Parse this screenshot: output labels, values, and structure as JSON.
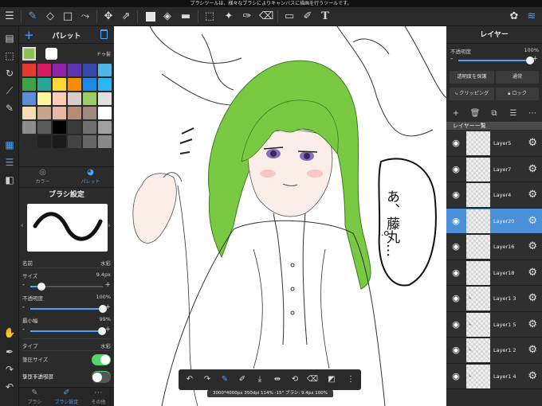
{
  "banner": "ブラシツールは、様々なブラシによりキャンバスに描画を行うツールです。",
  "palette": {
    "title": "パレット",
    "name": "ドゥ髪",
    "main_color": "#8cc152",
    "colors": [
      "#e53935",
      "#d81b60",
      "#8e24aa",
      "#5e35b1",
      "#3949ab",
      "#4fb8e8",
      "#43a047",
      "#26a69a",
      "#fdd835",
      "#fb8c00",
      "#1e88e5",
      "#29b6f6",
      "#5c8fd6",
      "#fff59d",
      "#ffccbc",
      "#d7ccc8",
      "#9ccc65",
      "#e0e0e0",
      "#f5deb3",
      "#c8a58a",
      "#e6b8a8",
      "#b58c7a",
      "#a1887f",
      "#ffffff",
      "#8d8d8d",
      "#5a5a5a",
      "#000000",
      "#3a3a3a",
      "#707070",
      "#a0a0a0",
      "#2a2a2a",
      "#222222",
      "#1a1a1a",
      "#444444",
      "#666666",
      "#888888"
    ]
  },
  "left_tabs": {
    "color": "カラー",
    "palette": "パレット"
  },
  "brush_settings": {
    "title": "ブラシ設定",
    "name_label": "名前",
    "name_value": "水彩",
    "size_label": "サイズ",
    "size_value": "9.4px",
    "size_level": 0.15,
    "opacity_label": "不透明度",
    "opacity_value": "100%",
    "opacity_level": 1.0,
    "min_width_label": "最小幅",
    "min_width_value": "99%",
    "min_width_level": 0.99,
    "type_label": "タイプ",
    "type_value": "水彩",
    "pen_size_label": "筆圧サイズ",
    "pen_size_on": true,
    "pen_opacity_label": "筆圧不透明度",
    "pen_opacity_on": true,
    "soft_edge_label": "ソフトエッジ",
    "soft_edge_on": false
  },
  "bottom_left_tabs": {
    "brush": "ブラシ",
    "brush_settings": "ブラシ設定",
    "other": "その他"
  },
  "statusbar": "3000*4000px 350dpi 114% -15° ブラシ: 9.4px 100%",
  "canvas_text": {
    "speech": "あ、藤丸…",
    "dot": ".o"
  },
  "layers_panel": {
    "title": "レイヤー",
    "opacity_label": "不透明度",
    "opacity_value": "100%",
    "opacity_level": 1.0,
    "protect_alpha": "透明度を保護",
    "blend_mode": "通常",
    "clipping": "クリッピング",
    "lock": "ロック",
    "list_header": "レイヤー一覧",
    "layers": [
      {
        "name": "Layer5",
        "selected": false
      },
      {
        "name": "Layer7",
        "selected": false
      },
      {
        "name": "Layer4",
        "selected": false
      },
      {
        "name": "Layer20",
        "selected": true
      },
      {
        "name": "Layer16",
        "selected": false
      },
      {
        "name": "Layer18",
        "selected": false
      },
      {
        "name": "Layer1 3",
        "selected": false,
        "clipped": true
      },
      {
        "name": "Layer1 5",
        "selected": false,
        "clipped": true
      },
      {
        "name": "Layer1 2",
        "selected": false,
        "clipped": true
      },
      {
        "name": "Layer1 4",
        "selected": false,
        "clipped": true
      }
    ]
  },
  "colors": {
    "accent": "#4aa3ff",
    "selected_layer": "#4a90d9",
    "toggle_on": "#4cd964",
    "hair": "#7ac943"
  }
}
